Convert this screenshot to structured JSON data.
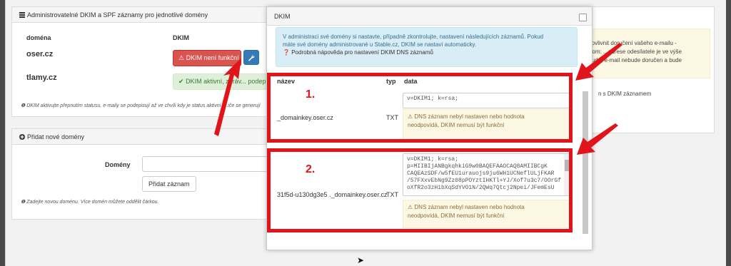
{
  "panel_dkim": {
    "title": "Administrovatelné DKIM a SPF záznamy pro jednotlivé domény",
    "col_domain": "doména",
    "col_dkim": "DKIM",
    "rows": [
      {
        "domain": "oser.cz",
        "status": "DKIM není funkční",
        "status_color": "#d9534f"
      },
      {
        "domain": "tlamy.cz",
        "status": "DKIM aktivní, zpráv... podepis",
        "status_color": "#dff0d8"
      }
    ],
    "note": "DKIM aktivujte přepnutím statusu, e-maily se podepisují až ve chvíli kdy je status aktivní. ...iče se generují"
  },
  "panel_add": {
    "title": "Přidat nové domény",
    "field_label": "Domény",
    "field_value": "",
    "submit_label": "Přidat záznam",
    "note": "Zadejte novou doménu. Více domén můžete oddělit čárkou."
  },
  "right_panel": {
    "warn_lines": [
      "e ovlivnit doručení vašeho e-mailu -",
      "From: ...adrese odesílatele je ve výše",
      "...ude, e-mail nebude doručen a bude"
    ],
    "text": "n s DKIM záznamem"
  },
  "modal": {
    "title": "DKIM",
    "info_line1": "V administraci své domény si nastavte, případně zkontrolujte, nastavení následujících záznamů. Pokud",
    "info_line2": "máte své domény administrované u Stable.cz, DKIM se nastaví automaticky.",
    "help_link": "Podrobná nápověda pro nastavení DKIM DNS záznamů",
    "col_name": "název",
    "col_type": "typ",
    "col_data": "data",
    "records": [
      {
        "name": "_domainkey.oser.cz",
        "type": "TXT",
        "data": "v=DKIM1; k=rsa;",
        "warning_line1": "DNS záznam nebyl nastaven nebo hodnota",
        "warning_line2": "neodpovídá, DKIM nemusí být funkční"
      },
      {
        "name": "31f5d-u130dg3e5 ._domainkey.oser.cz",
        "type": "TXT",
        "data": "v=DKIM1; k=rsa;\np=MIIBIjANBgkqhkiG9w0BAQEFAAOCAQ8AMIIBCgK\nCAQEAzSDF/w5fEU1urauojs9ju6WH1UCNeflULjFKAR\n/57FXxvEbNg9Zz08pPOYztIHKTl+YJ/Xof7u3c7/OOrGf\noXfR2o3zHibXqSdYVO1N/2QWq7Qtcj2Npei/JFemEsU",
        "warning_line1": "DNS záznam nebyl nastaven nebo hodnota",
        "warning_line2": "neodpovídá, DKIM nemusí být funkční"
      }
    ]
  },
  "annotations": {
    "label_1": "1.",
    "label_2": "2.",
    "color": "#e0141a"
  }
}
